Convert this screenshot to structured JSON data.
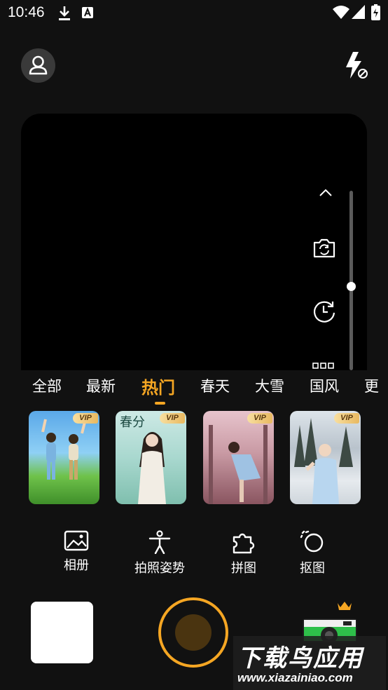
{
  "status_bar": {
    "time": "10:46",
    "icons": [
      "download-icon",
      "a-badge-icon",
      "wifi-icon",
      "signal-icon",
      "battery-charging-icon"
    ]
  },
  "header": {
    "profile_icon": "person-icon",
    "flash_icon": "flash-off-icon"
  },
  "viewfinder": {
    "controls": [
      "chevron-up-icon",
      "switch-camera-icon",
      "timer-icon",
      "more-icon"
    ],
    "zoom_level": 0.47
  },
  "category_tabs": {
    "items": [
      "全部",
      "最新",
      "热门",
      "春天",
      "大雪",
      "国风",
      "更"
    ],
    "active_index": 2
  },
  "templates": [
    {
      "badge": "VIP",
      "caption": ""
    },
    {
      "badge": "VIP",
      "caption": "春分"
    },
    {
      "badge": "VIP",
      "caption": ""
    },
    {
      "badge": "VIP",
      "caption": ""
    }
  ],
  "tools": [
    {
      "label": "相册",
      "icon": "image-icon"
    },
    {
      "label": "拍照姿势",
      "icon": "pose-icon"
    },
    {
      "label": "拼图",
      "icon": "puzzle-icon"
    },
    {
      "label": "抠图",
      "icon": "cutout-icon"
    }
  ],
  "bottom": {
    "crown_icon": "crown-icon",
    "camera_style_icon": "retro-camera-icon"
  },
  "watermark": {
    "title": "下载鸟应用",
    "url": "www.xiazainiao.com"
  },
  "colors": {
    "accent": "#f5a623",
    "background": "#111111"
  }
}
